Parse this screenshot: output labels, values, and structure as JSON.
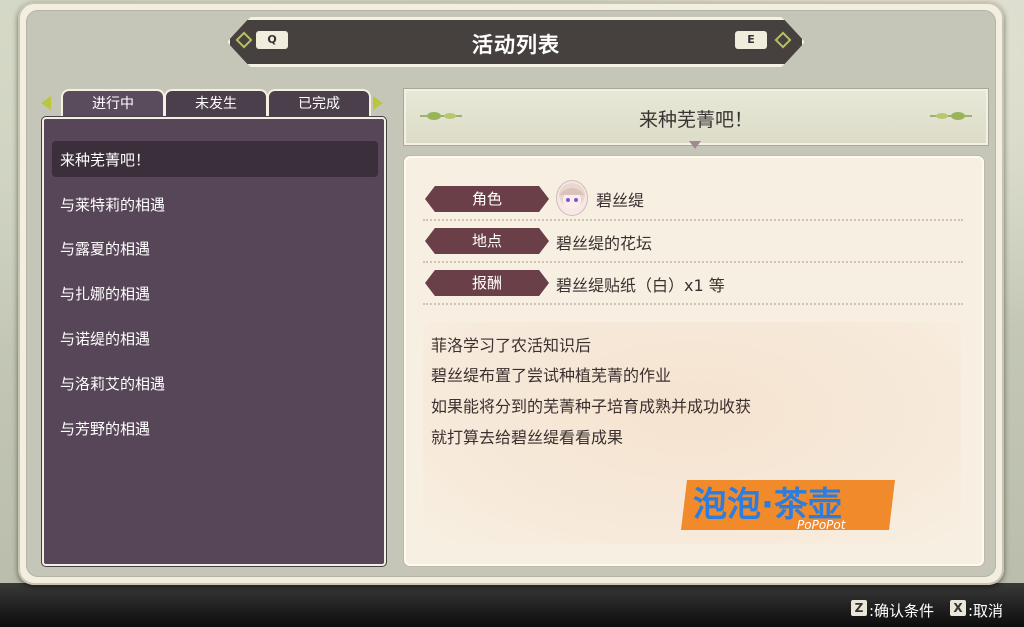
{
  "header": {
    "title": "活动列表",
    "left_key": "Q",
    "right_key": "E"
  },
  "tabs": [
    {
      "label": "进行中",
      "active": true
    },
    {
      "label": "未发生",
      "active": false
    },
    {
      "label": "已完成",
      "active": false
    }
  ],
  "event_list": [
    "来种芜菁吧！",
    "与莱特莉的相遇",
    "与露夏的相遇",
    "与扎娜的相遇",
    "与诺缇的相遇",
    "与洛莉艾的相遇",
    "与芳野的相遇"
  ],
  "selected_index": 0,
  "detail": {
    "title": "来种芜菁吧！",
    "fields": [
      {
        "tag": "角色",
        "value": "碧丝缇"
      },
      {
        "tag": "地点",
        "value": "碧丝缇的花坛"
      },
      {
        "tag": "报酬",
        "value": "碧丝缇贴纸（白）x1 等"
      }
    ],
    "description": [
      "菲洛学习了农活知识后",
      "碧丝缇布置了尝试种植芜菁的作业",
      "如果能将分到的芜菁种子培育成熟并成功收获",
      "就打算去给碧丝缇看看成果"
    ]
  },
  "watermark": {
    "main": "泡泡·茶壶",
    "sub": "PoPoPot",
    "color": "#f08a2a"
  },
  "controls": [
    {
      "key": "Z",
      "label": ":确认条件"
    },
    {
      "key": "X",
      "label": ":取消"
    }
  ],
  "colors": {
    "tab_bg": "#4b3f4c",
    "list_bg": "#574657",
    "tag_bg": "#6b3f48",
    "accent_green": "#b9c63e"
  }
}
